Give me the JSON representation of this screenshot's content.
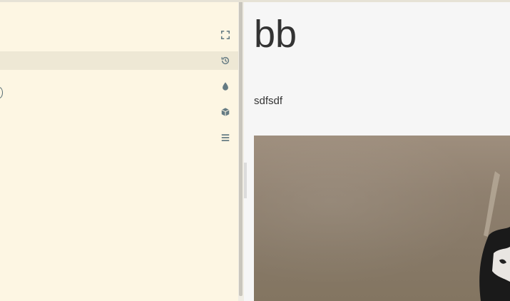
{
  "sidebar": {
    "icons": [
      {
        "name": "fullscreen-icon"
      },
      {
        "name": "history-icon"
      },
      {
        "name": "drop-icon"
      },
      {
        "name": "package-icon"
      },
      {
        "name": "menu-icon"
      }
    ]
  },
  "content": {
    "title": "bb",
    "body": "sdfsdf"
  },
  "colors": {
    "sidebar_bg": "#fdf6e3",
    "highlight": "#eee8d5",
    "icon": "#657b83",
    "content_bg": "#f6f6f6",
    "text": "#333333"
  }
}
